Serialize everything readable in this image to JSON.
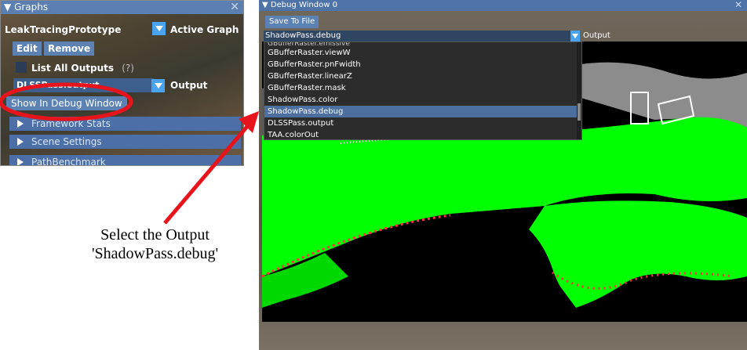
{
  "graphs_panel": {
    "title": "Graphs",
    "graph_name": "LeakTracingPrototype",
    "active_graph_label": "Active Graph",
    "edit_label": "Edit",
    "remove_label": "Remove",
    "list_all_outputs_label": "List All Outputs",
    "help_marker": "(?)",
    "output_value": "DLSSPass.output",
    "output_label": "Output",
    "show_in_debug_label": "Show In Debug Window",
    "headers": [
      "Framework Stats",
      "Scene Settings",
      "PathBenchmark"
    ]
  },
  "debug_window": {
    "title": "Debug Window 0",
    "save_label": "Save To File",
    "selected_output": "ShadowPass.debug",
    "output_label": "Output",
    "dropdown_items": [
      "GBufferRaster.emissive",
      "GBufferRaster.viewW",
      "GBufferRaster.pnFwidth",
      "GBufferRaster.linearZ",
      "GBufferRaster.mask",
      "ShadowPass.color",
      "ShadowPass.debug",
      "DLSSPass.output",
      "TAA.colorOut"
    ],
    "selected_index": 6
  },
  "annotation": {
    "line1": "Select the Output",
    "line2": "'ShadowPass.debug'",
    "color": "#e8141c"
  },
  "colors": {
    "title_bar": "#5b7fb1",
    "button": "#5c82b4",
    "combo_arrow": "#4aa3ee",
    "highlight": "#4d6f9f",
    "shadow_lit": "#00ff00"
  }
}
